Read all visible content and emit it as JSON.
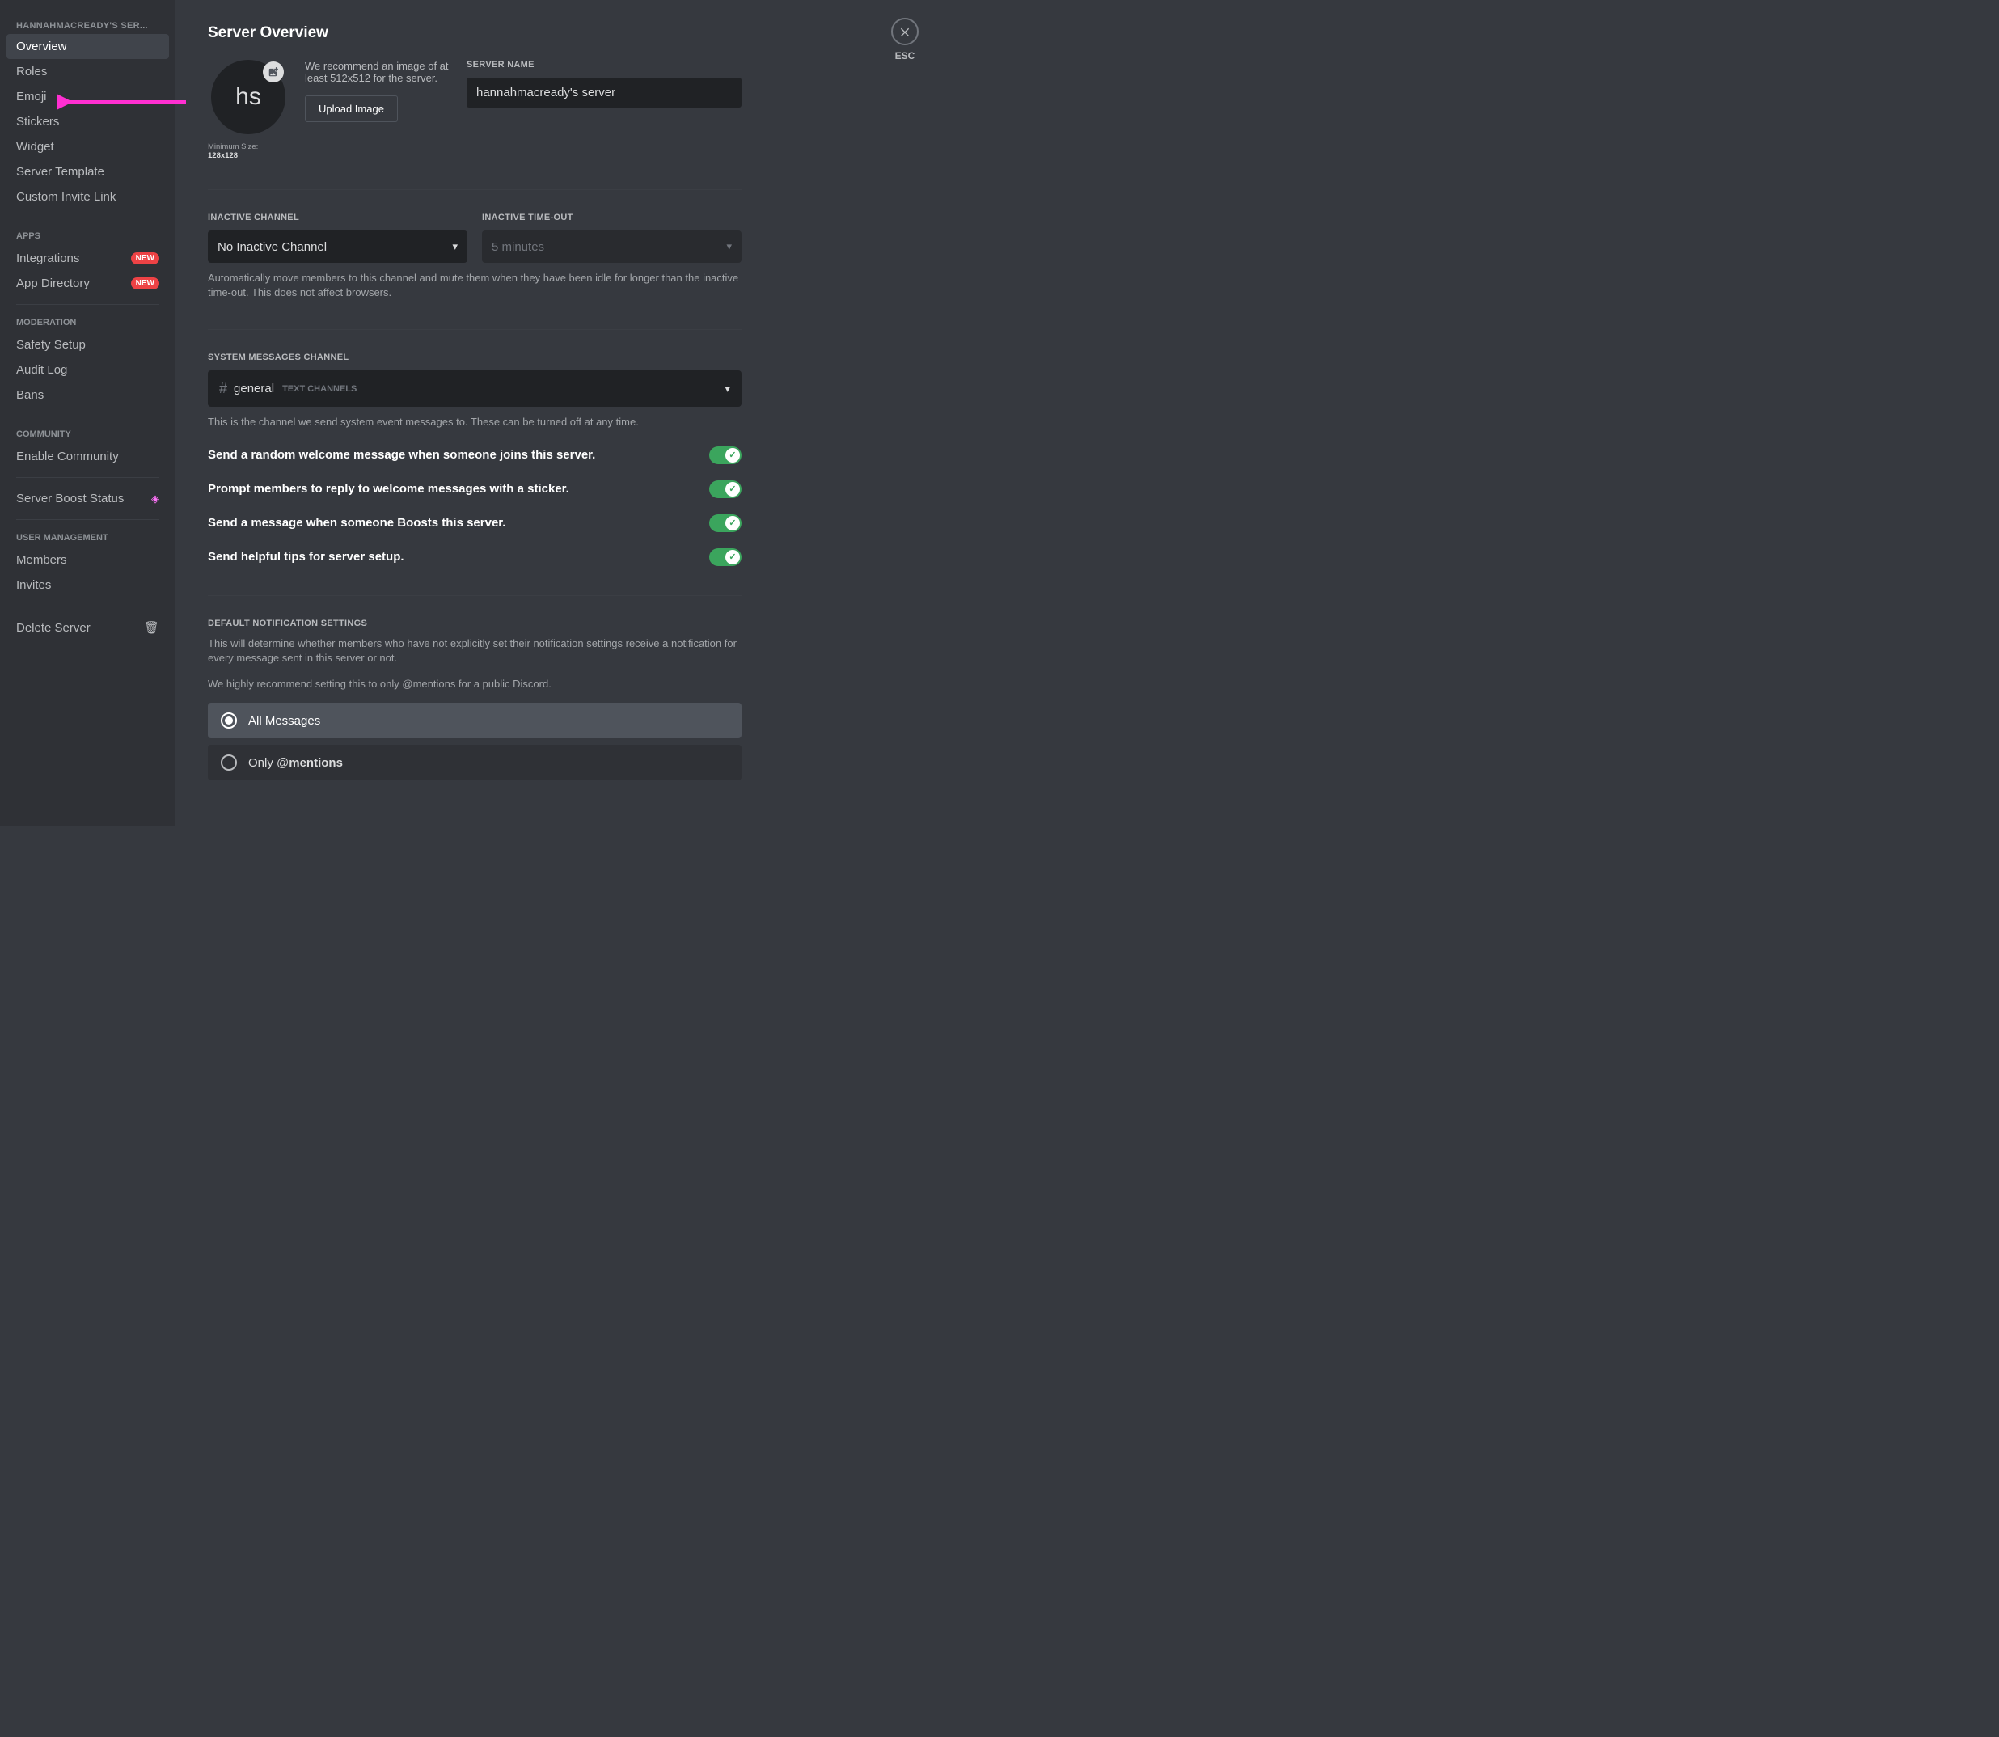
{
  "close_label": "ESC",
  "sidebar": {
    "header": "HANNAHMACREADY'S SER...",
    "settings": [
      {
        "label": "Overview",
        "active": true
      },
      {
        "label": "Roles"
      },
      {
        "label": "Emoji"
      },
      {
        "label": "Stickers"
      },
      {
        "label": "Widget"
      },
      {
        "label": "Server Template"
      },
      {
        "label": "Custom Invite Link"
      }
    ],
    "apps_header": "APPS",
    "apps": [
      {
        "label": "Integrations",
        "badge": "NEW"
      },
      {
        "label": "App Directory",
        "badge": "NEW"
      }
    ],
    "moderation_header": "MODERATION",
    "moderation": [
      {
        "label": "Safety Setup"
      },
      {
        "label": "Audit Log"
      },
      {
        "label": "Bans"
      }
    ],
    "community_header": "COMMUNITY",
    "community": [
      {
        "label": "Enable Community"
      }
    ],
    "boost_label": "Server Boost Status",
    "user_mgmt_header": "USER MANAGEMENT",
    "user_mgmt": [
      {
        "label": "Members"
      },
      {
        "label": "Invites"
      }
    ],
    "delete_label": "Delete Server"
  },
  "page": {
    "title": "Server Overview",
    "avatar_initials": "hs",
    "min_size_prefix": "Minimum Size: ",
    "min_size_value": "128x128",
    "recommend_text": "We recommend an image of at least 512x512 for the server.",
    "upload_button": "Upload Image",
    "server_name_label": "SERVER NAME",
    "server_name_value": "hannahmacready's server",
    "inactive_channel_label": "INACTIVE CHANNEL",
    "inactive_channel_value": "No Inactive Channel",
    "inactive_timeout_label": "INACTIVE TIME-OUT",
    "inactive_timeout_value": "5 minutes",
    "inactive_helper": "Automatically move members to this channel and mute them when they have been idle for longer than the inactive time-out. This does not affect browsers.",
    "system_channel_label": "SYSTEM MESSAGES CHANNEL",
    "system_channel_name": "general",
    "system_channel_category": "TEXT CHANNELS",
    "system_channel_helper": "This is the channel we send system event messages to. These can be turned off at any time.",
    "toggles": [
      {
        "label": "Send a random welcome message when someone joins this server."
      },
      {
        "label": "Prompt members to reply to welcome messages with a sticker."
      },
      {
        "label": "Send a message when someone Boosts this server."
      },
      {
        "label": "Send helpful tips for server setup."
      }
    ],
    "notif_label": "DEFAULT NOTIFICATION SETTINGS",
    "notif_helper1": "This will determine whether members who have not explicitly set their notification settings receive a notification for every message sent in this server or not.",
    "notif_helper2": "We highly recommend setting this to only @mentions for a public Discord.",
    "radio_all": "All Messages",
    "radio_only_prefix": "Only @",
    "radio_only_bold": "mentions"
  }
}
